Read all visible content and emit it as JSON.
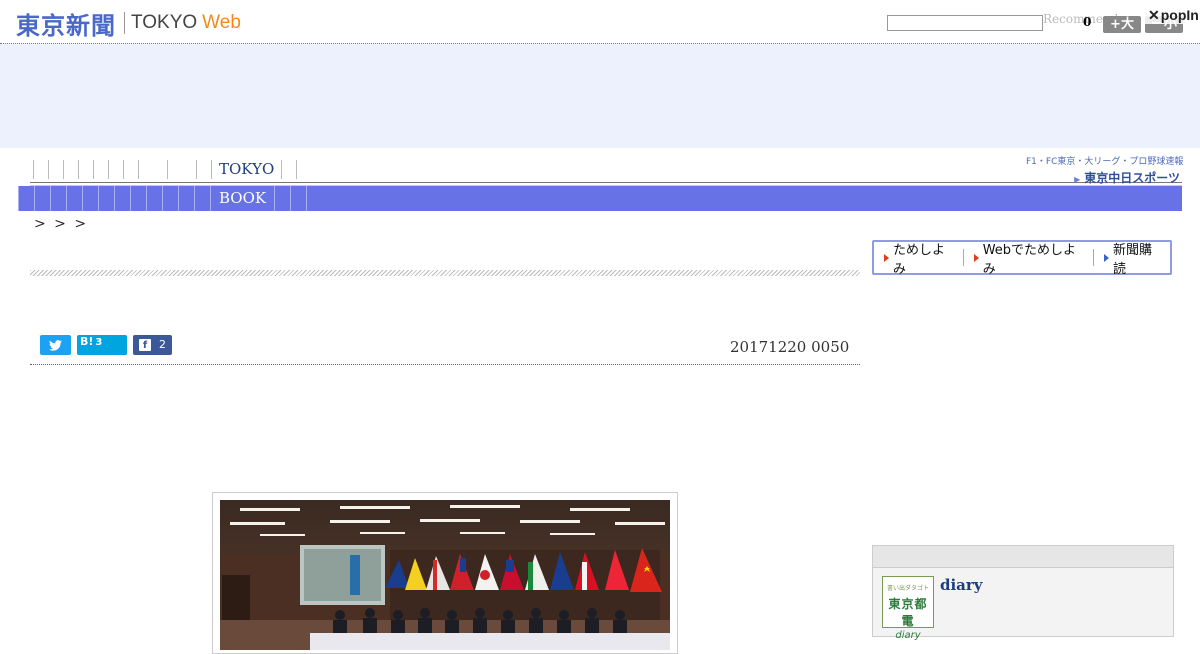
{
  "header": {
    "logo_jp": "東京新聞",
    "logo_tokyo": "TOKYO",
    "logo_web": "Web",
    "search_placeholder": "",
    "recommend_label": "Recommend",
    "counter": "0",
    "font_large_label": "+大",
    "font_small_label": "ー小",
    "popin_label": "popIn"
  },
  "nav1": {
    "items": [
      "",
      "",
      "",
      "",
      "",
      "",
      "",
      "",
      "",
      "",
      "",
      "TOKYO"
    ]
  },
  "sports_banner": {
    "top_line": "F1・FC東京・大リーグ・プロ野球速報",
    "logo": "東京中日スポーツ"
  },
  "nav2": {
    "items": [
      "",
      "",
      "",
      "",
      "",
      "",
      "",
      "",
      "",
      "",
      "",
      "",
      "BOOK",
      "",
      ""
    ]
  },
  "breadcrumb": "> > >",
  "article": {
    "date": "20171220 0050",
    "share": {
      "hatena_label": "B!",
      "hatena_count": "3",
      "facebook_label": "f",
      "facebook_count": "2"
    }
  },
  "promo": {
    "items": [
      "ためしよみ",
      "Webでためしよみ",
      "新聞購読"
    ]
  },
  "diary": {
    "label": "diary",
    "thumb_line1": "書い出ダタゴト",
    "thumb_line2": "東京都電",
    "thumb_line3": "diary"
  },
  "colors": {
    "brand_blue": "#4a68c8",
    "nav_bar": "#6672e6",
    "web_orange": "#f08a1c",
    "twitter": "#1da1f2",
    "hatena": "#00a4de",
    "facebook": "#3b5998"
  }
}
